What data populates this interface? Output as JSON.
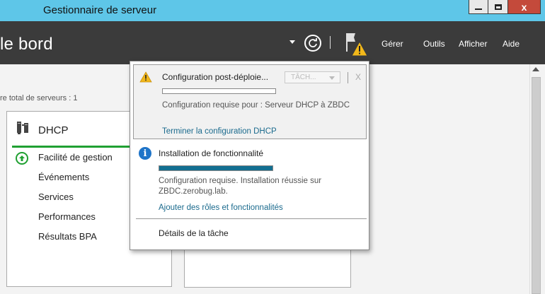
{
  "window": {
    "title": "Gestionnaire de serveur",
    "buttons": {
      "minimize": "",
      "maximize": "",
      "close": "x"
    }
  },
  "header": {
    "page_title": "le bord",
    "menu": [
      "Gérer",
      "Outils",
      "Afficher",
      "Aide"
    ]
  },
  "content": {
    "server_count": "re total de serveurs : 1",
    "role_tile": {
      "title": "DHCP",
      "items": [
        "Facilité de gestion",
        "Événements",
        "Services",
        "Performances",
        "Résultats BPA"
      ]
    }
  },
  "notifications": [
    {
      "title": "Configuration post-déploie...",
      "task_dropdown": "TÂCH...",
      "close": "X",
      "progress": 0,
      "text": "Configuration requise pour : Serveur DHCP à ZBDC",
      "link": "Terminer la configuration DHCP",
      "icon": "warning-icon"
    },
    {
      "title": "Installation de fonctionnalité",
      "progress": 1.0,
      "text_line1": "Configuration requise. Installation réussie sur",
      "text_line2": "ZBDC.zerobug.lab.",
      "link": "Ajouter des rôles et fonctionnalités",
      "icon": "info-icon"
    }
  ],
  "task_details": "Détails de la tâche",
  "colors": {
    "titlebar": "#5ec6e8",
    "header": "#3b3b3b",
    "accent_green": "#20a032",
    "progress_fill": "#126f91",
    "link": "#1a6a8d",
    "warning": "#f2b81a"
  }
}
